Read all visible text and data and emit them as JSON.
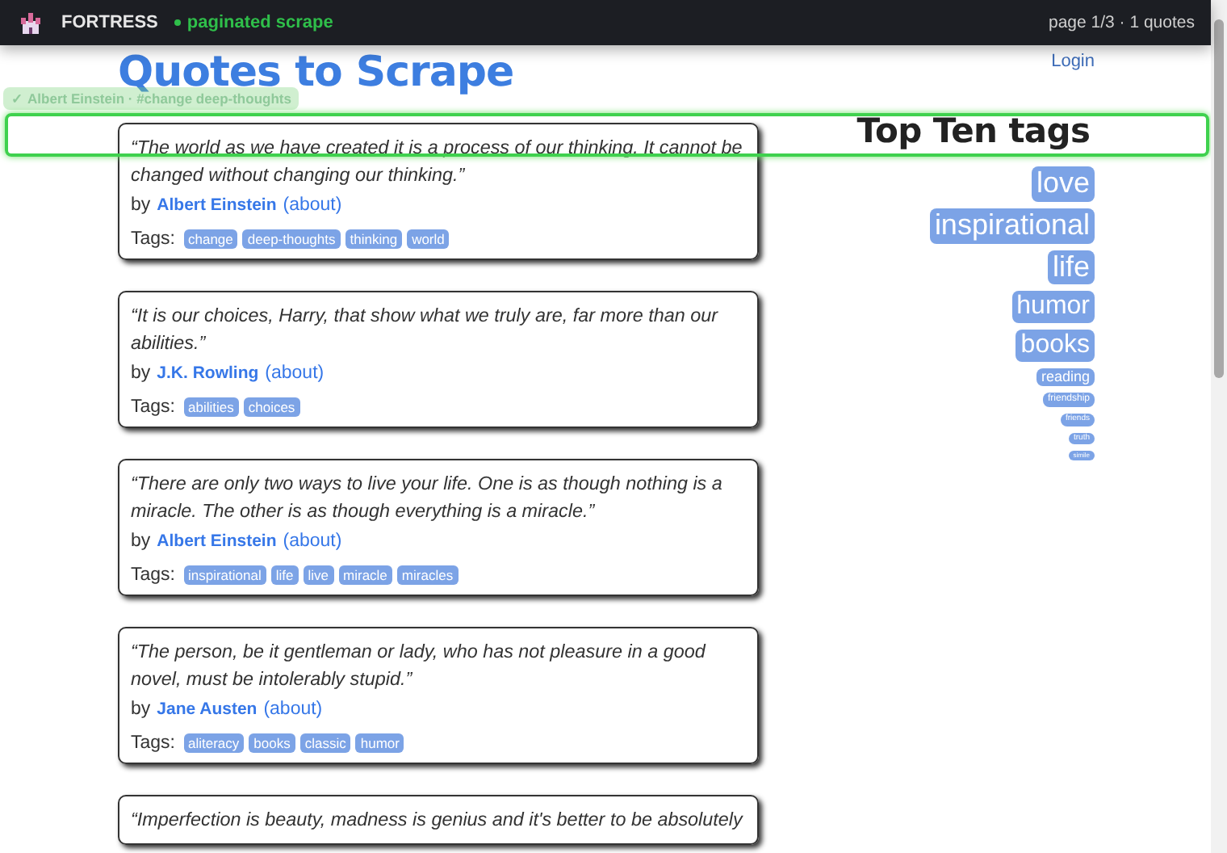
{
  "top_bar": {
    "brand": "FORTRESS",
    "status": {
      "label": "paginated scrape",
      "color": "#2fbf4a"
    },
    "page_info": "page 1/3 · 1 quotes"
  },
  "header": {
    "title": "Quotes to Scrape",
    "login": "Login"
  },
  "highlight": {
    "chip": "✓ Albert Einstein · #change deep-thoughts"
  },
  "quotes": [
    {
      "text": "“The world as we have created it is a process of our thinking. It cannot be changed without changing our thinking.”",
      "by": "by",
      "author": "Albert Einstein",
      "about": "(about)",
      "tags_label": "Tags:",
      "tags": [
        "change",
        "deep-thoughts",
        "thinking",
        "world"
      ]
    },
    {
      "text": "“It is our choices, Harry, that show what we truly are, far more than our abilities.”",
      "by": "by",
      "author": "J.K. Rowling",
      "about": "(about)",
      "tags_label": "Tags:",
      "tags": [
        "abilities",
        "choices"
      ]
    },
    {
      "text": "“There are only two ways to live your life. One is as though nothing is a miracle. The other is as though everything is a miracle.”",
      "by": "by",
      "author": "Albert Einstein",
      "about": "(about)",
      "tags_label": "Tags:",
      "tags": [
        "inspirational",
        "life",
        "live",
        "miracle",
        "miracles"
      ]
    },
    {
      "text": "“The person, be it gentleman or lady, who has not pleasure in a good novel, must be intolerably stupid.”",
      "by": "by",
      "author": "Jane Austen",
      "about": "(about)",
      "tags_label": "Tags:",
      "tags": [
        "aliteracy",
        "books",
        "classic",
        "humor"
      ]
    },
    {
      "text": "“Imperfection is beauty, madness is genius and it's better to be absolutely"
    }
  ],
  "top_tags": {
    "title": "Top Ten tags",
    "tags": [
      {
        "label": "love",
        "kind": "huge"
      },
      {
        "label": "inspirational",
        "kind": "huge"
      },
      {
        "label": "life",
        "kind": "huge"
      },
      {
        "label": "humor",
        "kind": "large"
      },
      {
        "label": "books",
        "kind": "large"
      },
      {
        "label": "reading",
        "kind": "medium"
      },
      {
        "label": "friendship",
        "kind": "small"
      },
      {
        "label": "friends",
        "kind": "tiny"
      },
      {
        "label": "truth",
        "kind": "tiny"
      },
      {
        "label": "simile",
        "kind": "minute"
      }
    ]
  }
}
